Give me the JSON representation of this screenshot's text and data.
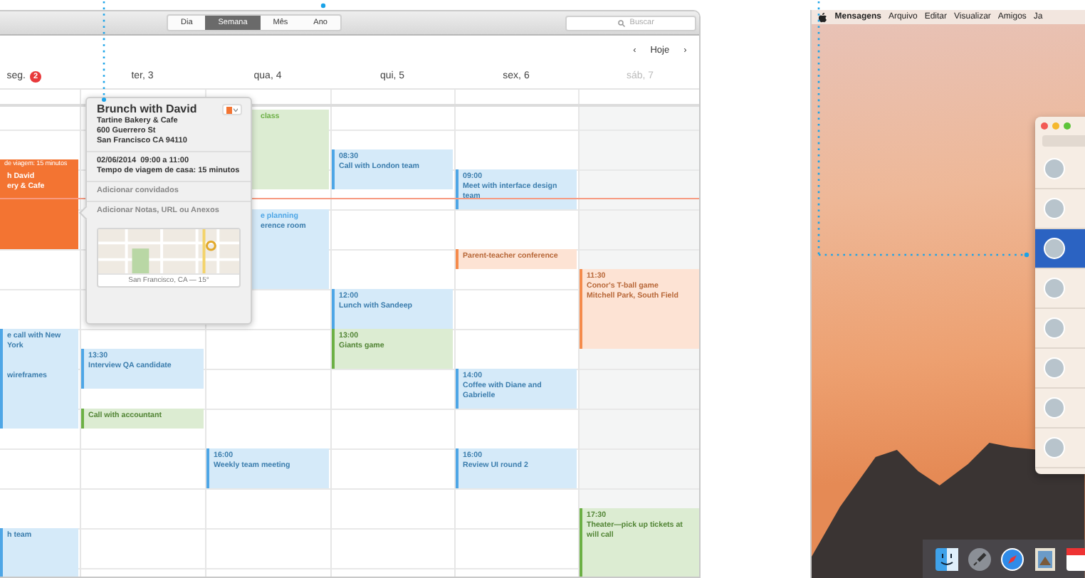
{
  "calendar": {
    "views": [
      {
        "label": "Dia",
        "selected": false
      },
      {
        "label": "Semana",
        "selected": true
      },
      {
        "label": "Mês",
        "selected": false
      },
      {
        "label": "Ano",
        "selected": false
      }
    ],
    "search": {
      "placeholder": "Buscar"
    },
    "nav": {
      "prev": "‹",
      "today": "Hoje",
      "next": "›"
    },
    "days": [
      {
        "label": "seg.",
        "badge": "2",
        "weekend": false,
        "events": [
          {
            "kind": "travel",
            "title": "de viagem: 15 minutos",
            "color": "#f37432",
            "selected": true
          },
          {
            "kind": "event",
            "title": "h David",
            "location": "ery & Cafe",
            "color": "#f37432",
            "selected": true
          },
          {
            "kind": "event",
            "title": "e call with New York",
            "color": "#4ea6e6",
            "selected": false
          },
          {
            "kind": "event",
            "title": "wireframes",
            "color": "#4ea6e6",
            "selected": false
          },
          {
            "kind": "event",
            "title": "h team",
            "color": "#4ea6e6",
            "selected": false
          }
        ]
      },
      {
        "label": "ter, 3",
        "weekend": false,
        "events": [
          {
            "kind": "event",
            "time": "13:30",
            "title": "Interview QA candidate",
            "color": "#4ea6e6",
            "selected": false
          },
          {
            "kind": "event",
            "title": "Call with accountant",
            "color": "#6cb045",
            "selected": false
          }
        ]
      },
      {
        "label": "qua, 4",
        "weekend": false,
        "events": [
          {
            "kind": "event",
            "title": "class",
            "color": "#6cb045",
            "selected": false
          },
          {
            "kind": "event",
            "title": "e planning",
            "location": "erence room",
            "color": "#4ea6e6",
            "selected": false
          },
          {
            "kind": "event",
            "time": "16:00",
            "title": "Weekly team meeting",
            "color": "#4ea6e6",
            "selected": false
          }
        ]
      },
      {
        "label": "qui, 5",
        "weekend": false,
        "events": [
          {
            "kind": "event",
            "time": "08:30",
            "title": "Call with London team",
            "color": "#4ea6e6",
            "selected": false
          },
          {
            "kind": "event",
            "time": "12:00",
            "title": "Lunch with Sandeep",
            "color": "#4ea6e6",
            "selected": false
          },
          {
            "kind": "event",
            "time": "13:00",
            "title": "Giants game",
            "color": "#6cb045",
            "selected": false
          }
        ]
      },
      {
        "label": "sex, 6",
        "weekend": false,
        "events": [
          {
            "kind": "event",
            "time": "09:00",
            "title": "Meet with interface design team",
            "color": "#4ea6e6",
            "selected": false
          },
          {
            "kind": "event",
            "title": "Parent-teacher conference",
            "color": "#f58b4c",
            "selected": false
          },
          {
            "kind": "event",
            "time": "14:00",
            "title": "Coffee with Diane and Gabrielle",
            "color": "#4ea6e6",
            "selected": false
          },
          {
            "kind": "event",
            "time": "16:00",
            "title": "Review UI round 2",
            "color": "#4ea6e6",
            "selected": false
          }
        ]
      },
      {
        "label": "sáb, 7",
        "weekend": true,
        "events": [
          {
            "kind": "event",
            "time": "11:30",
            "title": "Conor's T-ball game",
            "location": "Mitchell Park, South Field",
            "color": "#f58b4c",
            "selected": false
          },
          {
            "kind": "event",
            "time": "17:30",
            "title": "Theater—pick up tickets at will call",
            "color": "#6cb045",
            "selected": false
          }
        ]
      }
    ],
    "popup": {
      "title": "Brunch with David",
      "color": "#f37432",
      "address": [
        "Tartine Bakery & Cafe",
        "600 Guerrero St",
        "San Francisco CA 94110"
      ],
      "datetime": "02/06/2014  09:00 a 11:00",
      "travel": "Tempo de viagem de casa: 15 minutos",
      "invitees": "Adicionar convidados",
      "notes": "Adicionar Notas, URL ou Anexos",
      "map_caption": "San Francisco, CA — 15°"
    }
  },
  "desktop": {
    "menu": [
      {
        "label": "Mensagens",
        "bold": true
      },
      {
        "label": "Arquivo",
        "bold": false
      },
      {
        "label": "Editar",
        "bold": false
      },
      {
        "label": "Visualizar",
        "bold": false
      },
      {
        "label": "Amigos",
        "bold": false
      },
      {
        "label": "Ja",
        "bold": false
      }
    ],
    "conversations": [
      {
        "selected": false
      },
      {
        "selected": false
      },
      {
        "selected": true
      },
      {
        "selected": false
      },
      {
        "selected": false
      },
      {
        "selected": false
      },
      {
        "selected": false
      },
      {
        "selected": false
      }
    ]
  }
}
